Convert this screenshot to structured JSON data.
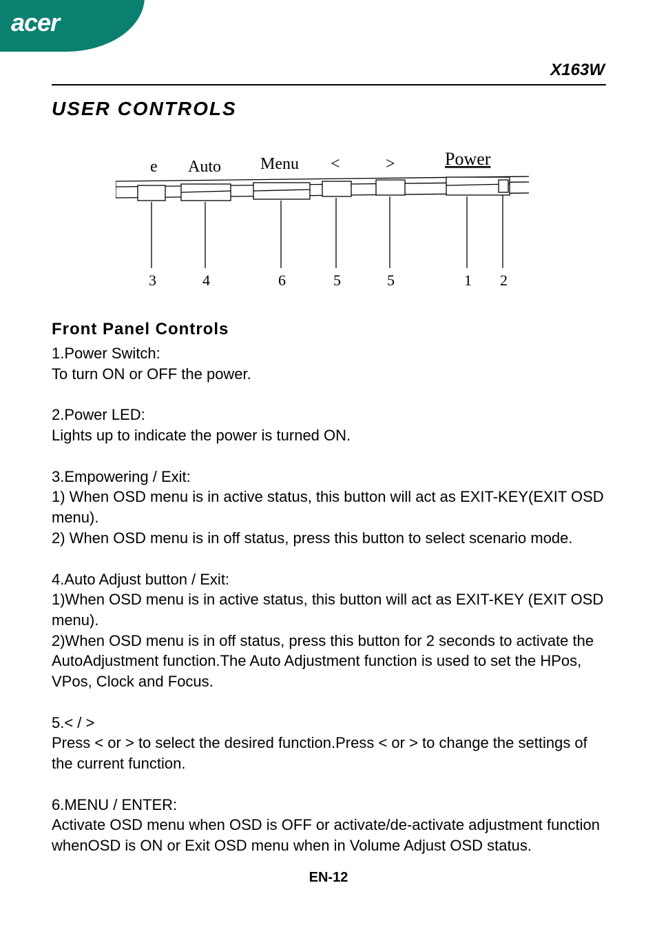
{
  "brand": "acer",
  "model": "X163W",
  "section_title": "USER  CONTROLS",
  "diagram": {
    "labels": {
      "e": "e",
      "auto": "Auto",
      "menu": "Menu",
      "lt": "<",
      "gt": ">",
      "power": "Power"
    },
    "numbers": [
      "3",
      "4",
      "6",
      "5",
      "5",
      "1",
      "2"
    ]
  },
  "subheading": "Front  Panel  Controls",
  "items": [
    {
      "title": "1.Power Switch:",
      "body": "To turn ON or OFF the power."
    },
    {
      "title": "2.Power LED:",
      "body": "Lights up to indicate the power is turned ON."
    },
    {
      "title": "3.Empowering / Exit:",
      "body": "1) When OSD menu is in active status, this button will act as EXIT-KEY(EXIT OSD menu).\n2) When OSD menu is in off status, press this button to select scenario mode."
    },
    {
      "title": "4.Auto Adjust button / Exit:",
      "body": "1)When OSD menu is in active status, this button will act as EXIT-KEY (EXIT OSD menu).\n2)When OSD menu is in off status, press this button for 2 seconds to activate the AutoAdjustment function.The Auto Adjustment function is used to set the HPos, VPos, Clock and Focus."
    },
    {
      "title": "5.< / >",
      "body": "Press < or  > to select the desired function.Press < or  > to change the settings of the current function."
    },
    {
      "title": "6.MENU / ENTER:",
      "body": "Activate OSD menu when OSD is OFF or activate/de-activate adjustment function whenOSD is ON or Exit OSD menu when in Volume Adjust OSD status."
    }
  ],
  "page_footer": "EN-12"
}
